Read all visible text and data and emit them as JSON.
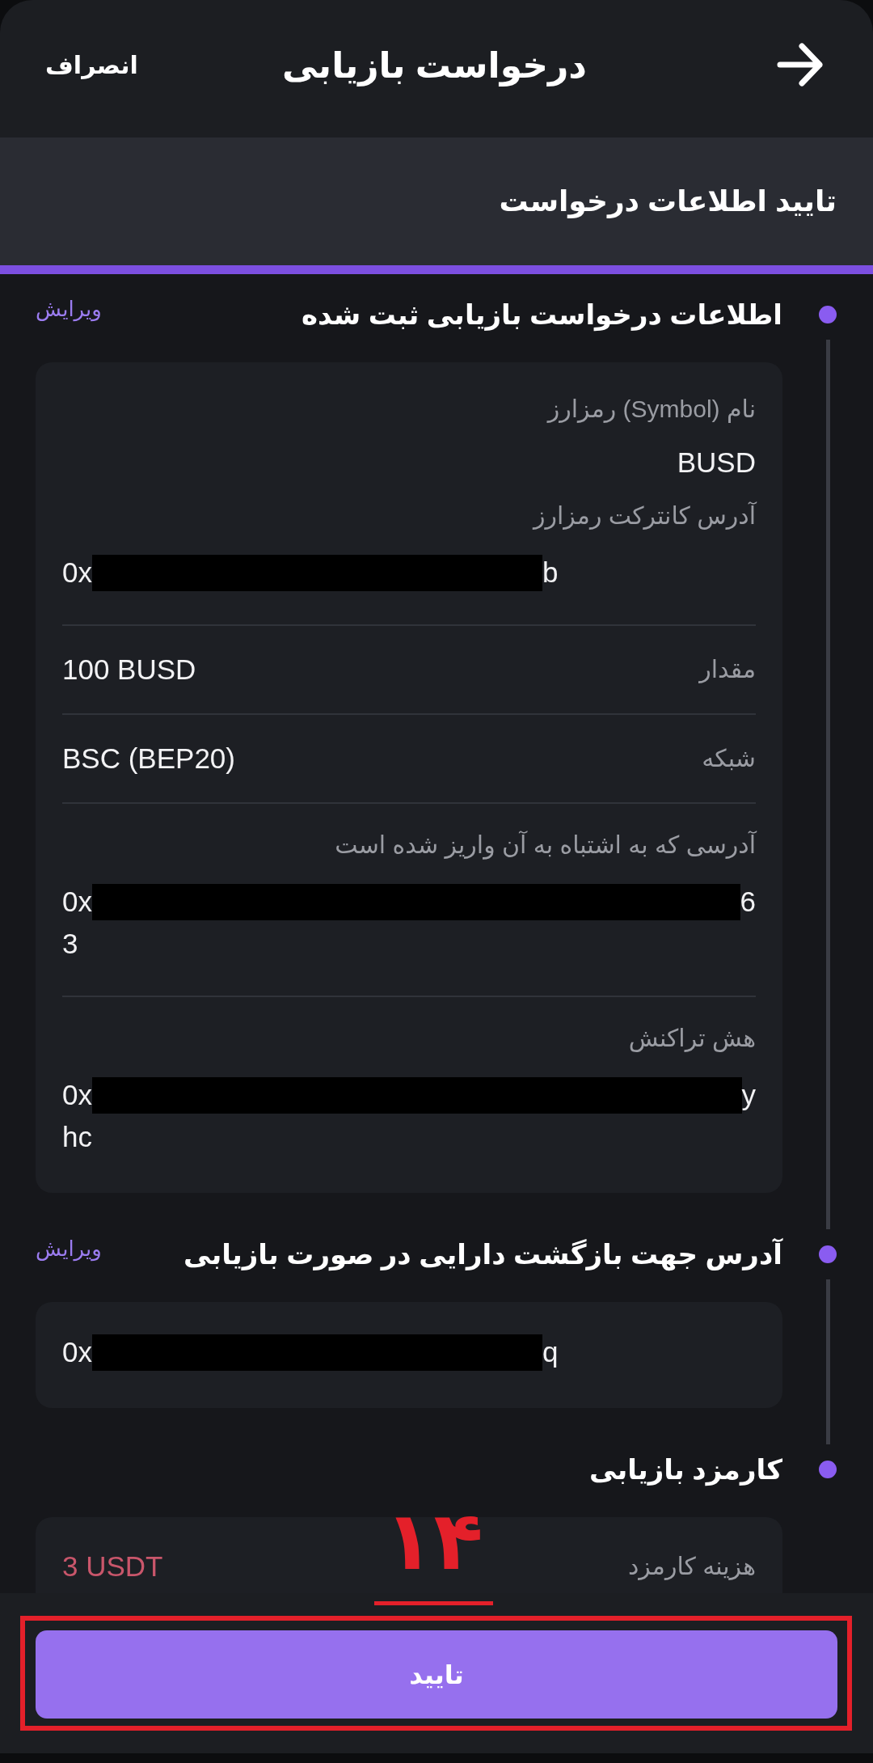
{
  "header": {
    "title": "درخواست بازیابی",
    "cancel": "انصراف"
  },
  "step": {
    "title": "تایید اطلاعات درخواست",
    "progress": {
      "level": 1
    }
  },
  "sections": [
    {
      "title": "اطلاعات درخواست بازیابی ثبت شده",
      "edit": "ویرایش",
      "groups": [
        [
          {
            "kind": "text",
            "label": "نام (Symbol) رمزارز",
            "value": "BUSD"
          },
          {
            "kind": "address",
            "label": "آدرس کانترکت رمزارز",
            "prefix": "0x",
            "redacted": true,
            "suffix": "b"
          }
        ],
        [
          {
            "kind": "inline",
            "label": "مقدار",
            "value": "100 BUSD",
            "negative": false
          }
        ],
        [
          {
            "kind": "inline",
            "label": "شبکه",
            "value": "BSC (BEP20)",
            "negative": false
          }
        ],
        [
          {
            "kind": "address",
            "label": "آدرسی که به اشتباه به آن واریز شده است",
            "prefix": "0x",
            "redacted": true,
            "suffix": "6",
            "continuation": "3"
          }
        ],
        [
          {
            "kind": "address",
            "label": "هش تراکنش",
            "prefix": "0x",
            "redacted": true,
            "suffix": "y",
            "continuation": "hc"
          }
        ]
      ]
    },
    {
      "title": "آدرس جهت بازگشت دارایی در صورت بازیابی",
      "edit": "ویرایش",
      "groups": [
        [
          {
            "kind": "address",
            "prefix": "0x",
            "redacted": true,
            "suffix": "q"
          }
        ]
      ]
    },
    {
      "title": "کارمزد بازیابی",
      "groups": [
        [
          {
            "kind": "inline",
            "label": "هزینه کارمزد",
            "value": "3 USDT",
            "negative": true
          }
        ]
      ]
    }
  ],
  "confirm_button": {
    "label": "تایید",
    "highlighted": true
  },
  "annotation": {
    "step_number": "۱۴"
  }
}
